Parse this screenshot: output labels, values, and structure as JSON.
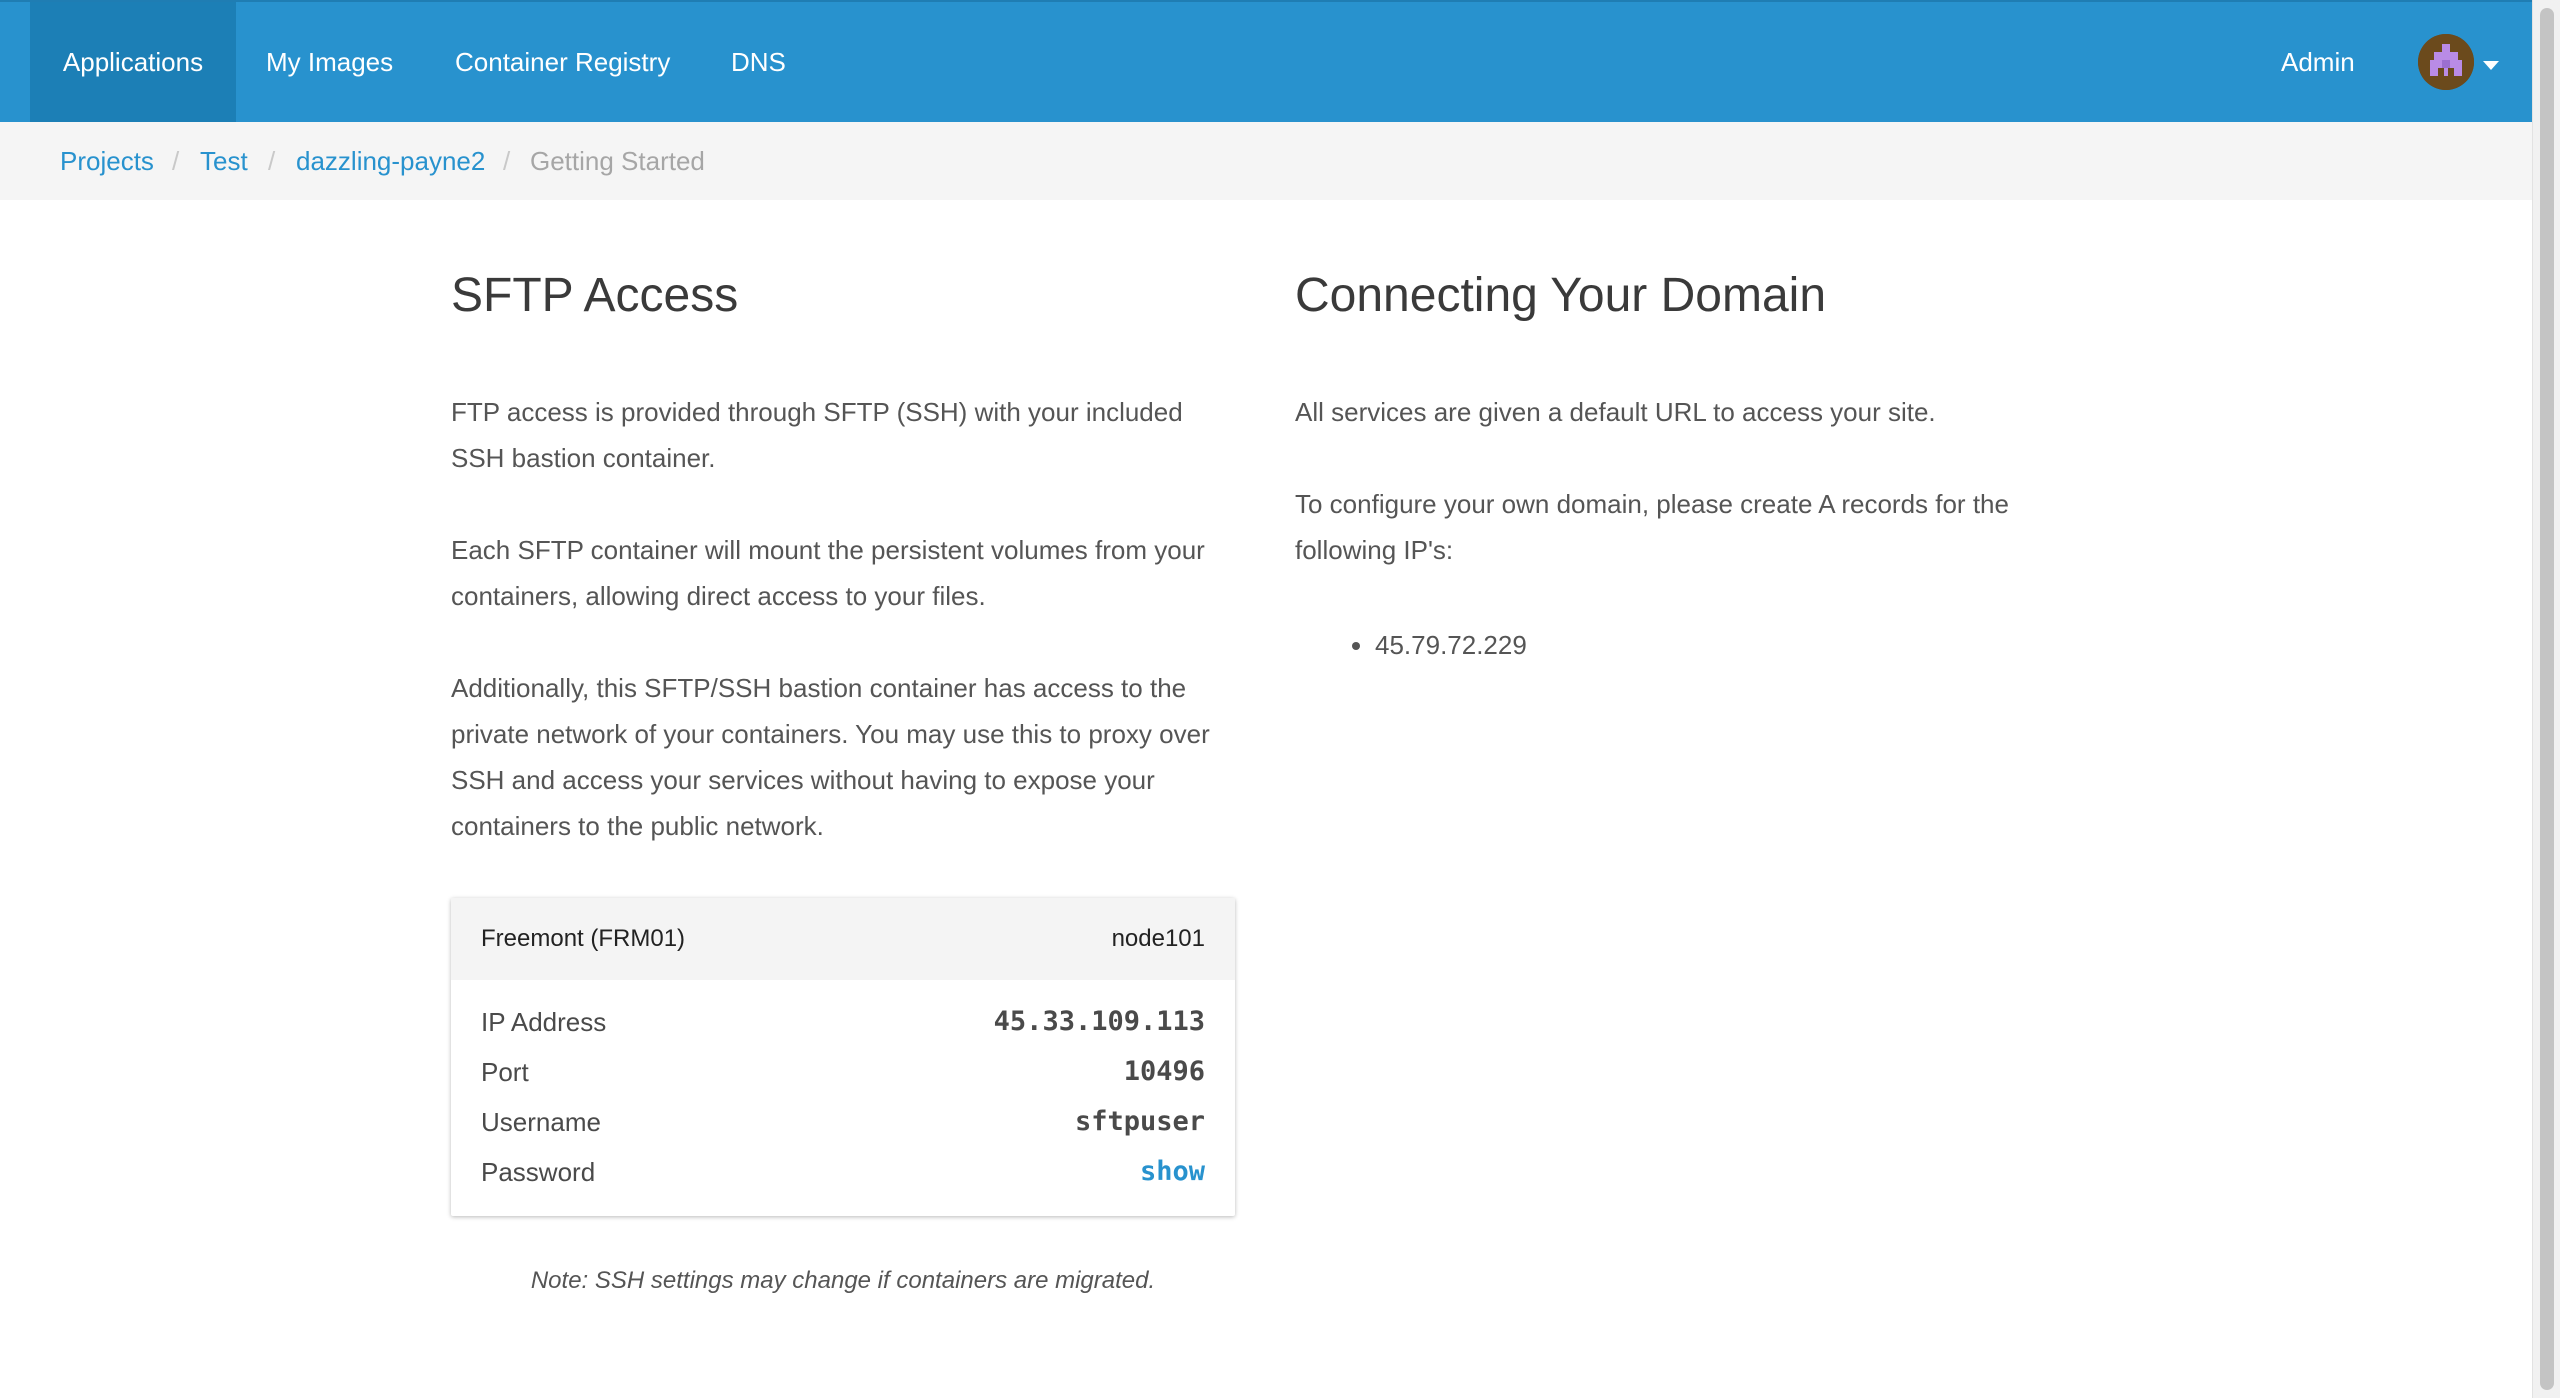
{
  "nav": {
    "items": [
      {
        "label": "Applications",
        "active": true
      },
      {
        "label": "My Images"
      },
      {
        "label": "Container Registry"
      },
      {
        "label": "DNS"
      }
    ],
    "admin_label": "Admin",
    "avatar_icon": "pixel-avatar",
    "menu_icon": "caret-down-icon"
  },
  "breadcrumb": {
    "items": [
      "Projects",
      "Test",
      "dazzling-payne2",
      "Getting Started"
    ],
    "separator": "/"
  },
  "sftp": {
    "title": "SFTP Access",
    "paragraphs": [
      "FTP access is provided through SFTP (SSH) with your included SSH bastion container.",
      "Each SFTP container will mount the persistent volumes from your containers, allowing direct access to your files.",
      "Additionally, this SFTP/SSH bastion container has access to the private network of your containers. You may use this to proxy over SSH and access your services without having to expose your containers to the public network."
    ],
    "card": {
      "region": "Freemont (FRM01)",
      "node": "node101",
      "rows": [
        {
          "label": "IP Address",
          "value": "45.33.109.113"
        },
        {
          "label": "Port",
          "value": "10496"
        },
        {
          "label": "Username",
          "value": "sftpuser"
        },
        {
          "label": "Password",
          "value": "show"
        }
      ]
    },
    "note": "Note: SSH settings may change if containers are migrated."
  },
  "domain": {
    "title": "Connecting Your Domain",
    "paragraphs": [
      "All services are given a default URL to access your site.",
      "To configure your own domain, please create A records for the following IP's:"
    ],
    "ips": [
      "45.79.72.229"
    ]
  },
  "colors": {
    "navbar": "#2892ce",
    "navbar_active": "#1c7fb6",
    "link": "#2892ce",
    "breadcrumb_bg": "#f5f5f5"
  }
}
